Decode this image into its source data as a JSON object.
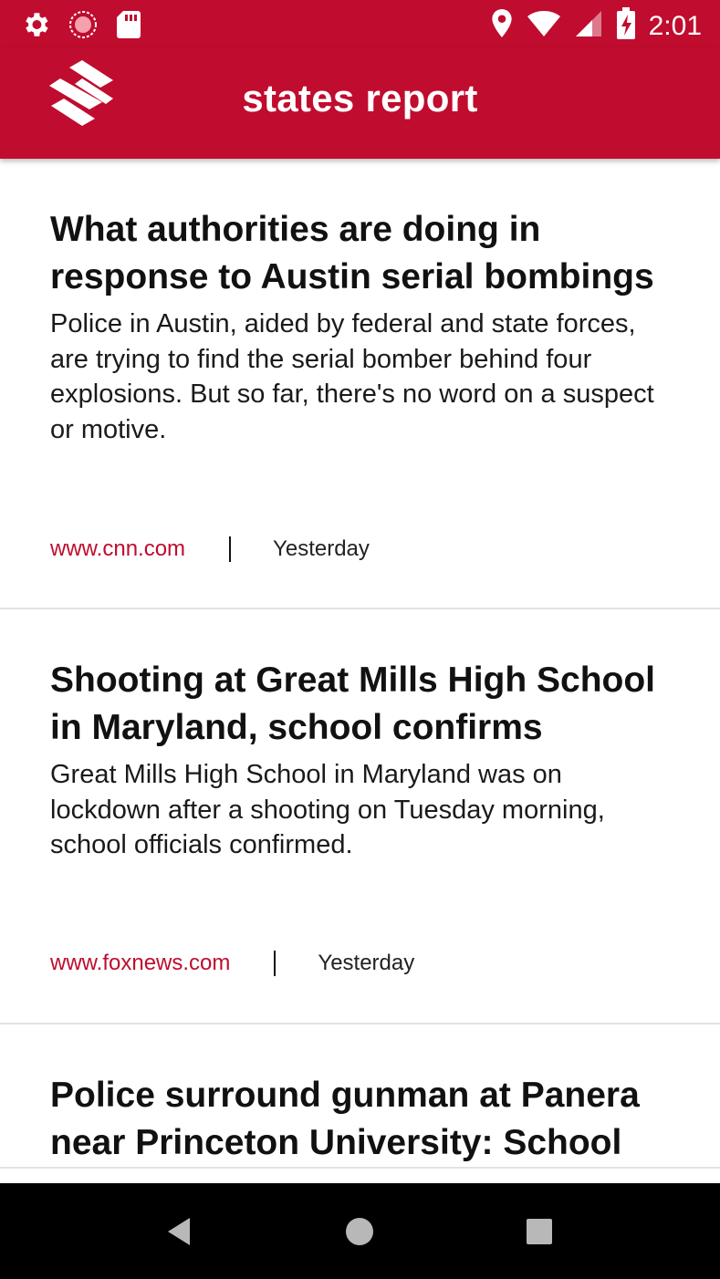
{
  "status_bar": {
    "time": "2:01",
    "left_icons": [
      "gear-icon",
      "sync-icon",
      "sd-card-icon"
    ],
    "right_icons": [
      "location-icon",
      "wifi-icon",
      "signal-icon",
      "battery-charging-icon"
    ]
  },
  "app_bar": {
    "title": "states report",
    "logo": "striped-s-logo"
  },
  "articles": [
    {
      "headline": "What authorities are doing in response to Austin serial bombings",
      "summary": "Police in Austin, aided by federal and state forces, are trying to find the serial bomber behind four explosions. But so far, there's no word on a suspect or motive.",
      "source": "www.cnn.com",
      "date": "Yesterday"
    },
    {
      "headline": "Shooting at Great Mills High School in Maryland, school confirms",
      "summary": "Great Mills High School in Maryland was on lockdown after a shooting on Tuesday morning, school officials confirmed.",
      "source": "www.foxnews.com",
      "date": "Yesterday"
    },
    {
      "headline": "Police surround gunman at Panera near Princeton University: School"
    }
  ],
  "nav_bar": {
    "buttons": [
      "back-icon",
      "home-icon",
      "recents-icon"
    ]
  },
  "colors": {
    "brand": "#c00c2e",
    "source_link": "#c00c2e",
    "divider": "#e2e2e2",
    "nav_bg": "#000000"
  }
}
